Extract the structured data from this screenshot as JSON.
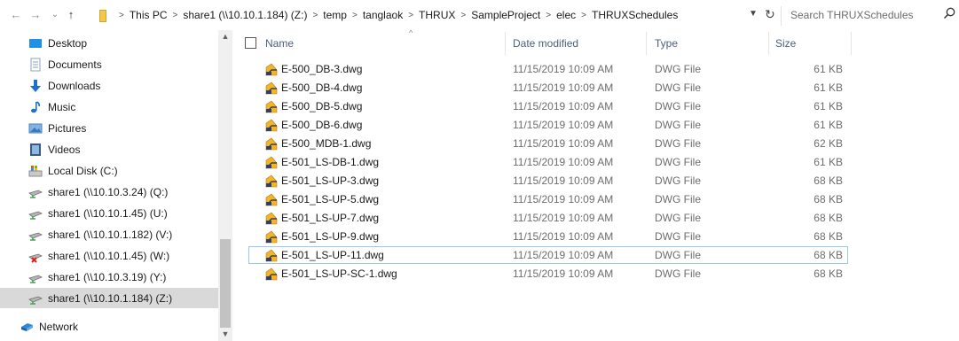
{
  "nav_buttons": {
    "back": "←",
    "forward": "→",
    "recent": "⌄",
    "up": "↑"
  },
  "breadcrumbs": [
    "This PC",
    "share1 (\\\\10.10.1.184) (Z:)",
    "temp",
    "tanglaok",
    "THRUX",
    "SampleProject",
    "elec",
    "THRUXSchedules"
  ],
  "search": {
    "placeholder": "Search THRUXSchedules"
  },
  "columns": {
    "name": "Name",
    "date": "Date modified",
    "type": "Type",
    "size": "Size"
  },
  "nav_items": [
    {
      "label": "Desktop",
      "icon": "desktop-icon"
    },
    {
      "label": "Documents",
      "icon": "documents-icon"
    },
    {
      "label": "Downloads",
      "icon": "downloads-icon"
    },
    {
      "label": "Music",
      "icon": "music-icon"
    },
    {
      "label": "Pictures",
      "icon": "pictures-icon"
    },
    {
      "label": "Videos",
      "icon": "videos-icon"
    },
    {
      "label": "Local Disk (C:)",
      "icon": "local-disk-icon"
    },
    {
      "label": "share1 (\\\\10.10.3.24) (Q:)",
      "icon": "network-drive-icon"
    },
    {
      "label": "share1 (\\\\10.10.1.45) (U:)",
      "icon": "network-drive-icon"
    },
    {
      "label": "share1 (\\\\10.10.1.182) (V:)",
      "icon": "network-drive-icon"
    },
    {
      "label": "share1 (\\\\10.10.1.45) (W:)",
      "icon": "disconnected-drive-icon"
    },
    {
      "label": "share1 (\\\\10.10.3.19) (Y:)",
      "icon": "network-drive-icon"
    },
    {
      "label": "share1 (\\\\10.10.1.184) (Z:)",
      "icon": "network-drive-icon",
      "selected": true
    },
    {
      "label": "Network",
      "icon": "network-icon"
    }
  ],
  "files": [
    {
      "name": "E-500_DB-3.dwg",
      "date": "11/15/2019 10:09 AM",
      "type": "DWG File",
      "size": "61 KB"
    },
    {
      "name": "E-500_DB-4.dwg",
      "date": "11/15/2019 10:09 AM",
      "type": "DWG File",
      "size": "61 KB"
    },
    {
      "name": "E-500_DB-5.dwg",
      "date": "11/15/2019 10:09 AM",
      "type": "DWG File",
      "size": "61 KB"
    },
    {
      "name": "E-500_DB-6.dwg",
      "date": "11/15/2019 10:09 AM",
      "type": "DWG File",
      "size": "61 KB"
    },
    {
      "name": "E-500_MDB-1.dwg",
      "date": "11/15/2019 10:09 AM",
      "type": "DWG File",
      "size": "62 KB"
    },
    {
      "name": "E-501_LS-DB-1.dwg",
      "date": "11/15/2019 10:09 AM",
      "type": "DWG File",
      "size": "61 KB"
    },
    {
      "name": "E-501_LS-UP-3.dwg",
      "date": "11/15/2019 10:09 AM",
      "type": "DWG File",
      "size": "68 KB"
    },
    {
      "name": "E-501_LS-UP-5.dwg",
      "date": "11/15/2019 10:09 AM",
      "type": "DWG File",
      "size": "68 KB"
    },
    {
      "name": "E-501_LS-UP-7.dwg",
      "date": "11/15/2019 10:09 AM",
      "type": "DWG File",
      "size": "68 KB"
    },
    {
      "name": "E-501_LS-UP-9.dwg",
      "date": "11/15/2019 10:09 AM",
      "type": "DWG File",
      "size": "68 KB"
    },
    {
      "name": "E-501_LS-UP-11.dwg",
      "date": "11/15/2019 10:09 AM",
      "type": "DWG File",
      "size": "68 KB",
      "focused": true
    },
    {
      "name": "E-501_LS-UP-SC-1.dwg",
      "date": "11/15/2019 10:09 AM",
      "type": "DWG File",
      "size": "68 KB"
    }
  ],
  "colors": {
    "selection": "#d9d9d9",
    "focus_outline": "#99c9ef",
    "header_text": "#4c607a"
  }
}
